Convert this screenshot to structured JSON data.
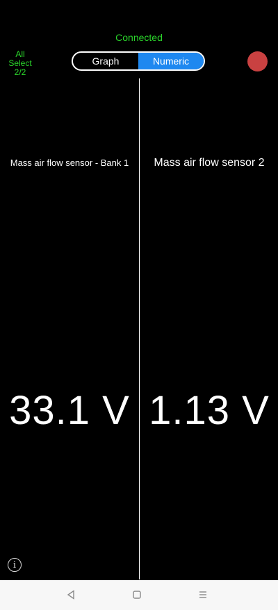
{
  "header": {
    "status": "Connected",
    "all_select": [
      "All",
      "Select",
      "2/2"
    ]
  },
  "view_toggle": {
    "graph_label": "Graph",
    "numeric_label": "Numeric",
    "selected": "Numeric"
  },
  "colors": {
    "accent_green": "#2bd62b",
    "toggle_active": "#1e88f0",
    "record_button": "#c94141"
  },
  "sensors": [
    {
      "label": "Mass air flow sensor  -  Bank 1",
      "value": "33.1 V"
    },
    {
      "label": "Mass air flow sensor 2",
      "value": "1.13 V"
    }
  ],
  "icons": {
    "record": "record-icon",
    "info": "info-icon",
    "nav_back": "back-icon",
    "nav_home": "home-icon",
    "nav_menu": "menu-icon"
  }
}
